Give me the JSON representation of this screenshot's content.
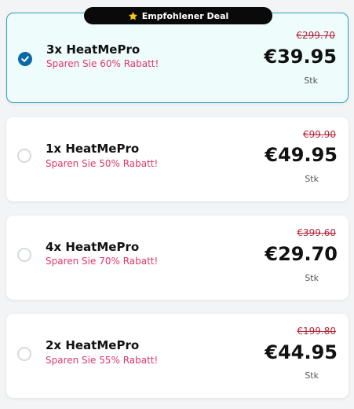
{
  "badge": {
    "label": "Empfohlener Deal",
    "icon": "star-icon"
  },
  "colors": {
    "selected_border": "#2fa3bd",
    "selected_bg": "#eefcfc",
    "radio_checked": "#0b6aa6",
    "savings_text": "#e2366b",
    "old_price": "#b3253a"
  },
  "offers": [
    {
      "title": "3x HeatMePro",
      "savings": "Sparen Sie 60% Rabatt!",
      "old_price": "€299.70",
      "price": "€39.95",
      "unit": "Stk",
      "selected": true
    },
    {
      "title": "1x HeatMePro",
      "savings": "Sparen Sie 50% Rabatt!",
      "old_price": "€99.90",
      "price": "€49.95",
      "unit": "Stk",
      "selected": false
    },
    {
      "title": "4x HeatMePro",
      "savings": "Sparen Sie 70% Rabatt!",
      "old_price": "€399.60",
      "price": "€29.70",
      "unit": "Stk",
      "selected": false
    },
    {
      "title": "2x HeatMePro",
      "savings": "Sparen Sie 55% Rabatt!",
      "old_price": "€199.80",
      "price": "€44.95",
      "unit": "Stk",
      "selected": false
    }
  ]
}
